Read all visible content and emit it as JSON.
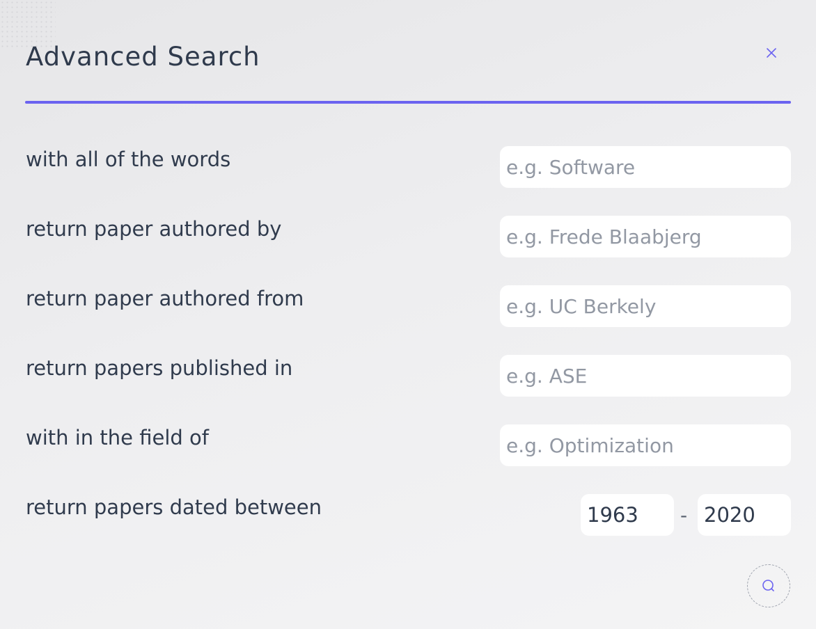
{
  "dialog": {
    "title": "Advanced Search",
    "close_icon": "close-icon",
    "accent_color": "#6b63f0"
  },
  "rows": {
    "words": {
      "label": "with all of the words",
      "placeholder": "e.g. Software",
      "value": ""
    },
    "author": {
      "label": "return paper authored by",
      "placeholder": "e.g. Frede Blaabjerg",
      "value": ""
    },
    "affiliation": {
      "label": "return paper authored from",
      "placeholder": "e.g. UC Berkely",
      "value": ""
    },
    "venue": {
      "label": "return papers published in",
      "placeholder": "e.g. ASE",
      "value": ""
    },
    "field": {
      "label": "with in the field of",
      "placeholder": "e.g. Optimization",
      "value": ""
    },
    "dates": {
      "label": "return papers dated between",
      "from": "1963",
      "separator": "-",
      "to": "2020"
    }
  },
  "search_button": {
    "icon": "search-icon"
  }
}
